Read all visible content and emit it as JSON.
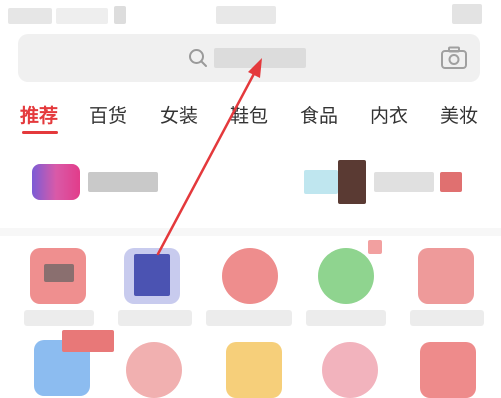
{
  "tabs": {
    "items": [
      {
        "label": "推荐",
        "active": true
      },
      {
        "label": "百货",
        "active": false
      },
      {
        "label": "女装",
        "active": false
      },
      {
        "label": "鞋包",
        "active": false
      },
      {
        "label": "食品",
        "active": false
      },
      {
        "label": "内衣",
        "active": false
      },
      {
        "label": "美妆",
        "active": false
      }
    ]
  },
  "colors": {
    "accent": "#e4393c",
    "search_bg": "#f0f0f0",
    "annotation_arrow": "#e4393c"
  },
  "icons": {
    "search": "search-icon",
    "camera": "camera-icon"
  }
}
